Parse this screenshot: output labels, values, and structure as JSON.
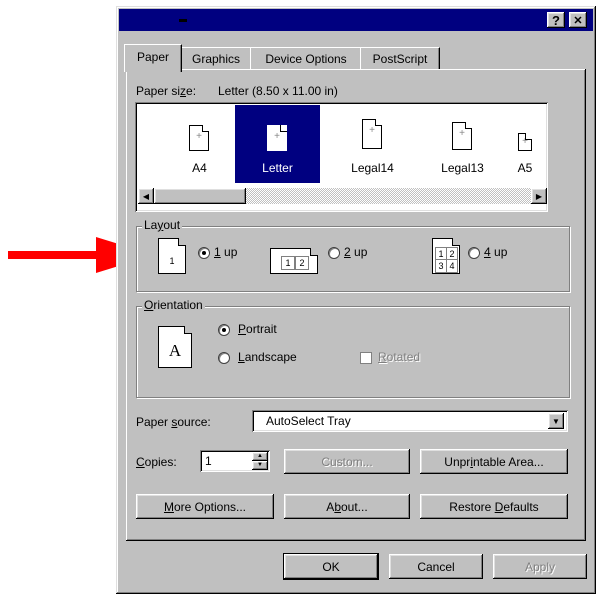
{
  "dialog": {
    "help_button": "?",
    "close_button": "✕"
  },
  "tabs": [
    {
      "label": "Paper"
    },
    {
      "label": "Graphics"
    },
    {
      "label": "Device Options"
    },
    {
      "label": "PostScript"
    }
  ],
  "paper": {
    "size_label": "Paper size:",
    "size_value": "Letter (8.50 x 11.00 in)",
    "items": [
      {
        "name": "A4"
      },
      {
        "name": "Letter"
      },
      {
        "name": "Legal14"
      },
      {
        "name": "Legal13"
      },
      {
        "name": "A5"
      }
    ],
    "selected": "Letter"
  },
  "layout": {
    "title": "Layout",
    "options": [
      {
        "label": "1 up",
        "checked": true
      },
      {
        "label": "2 up",
        "checked": false
      },
      {
        "label": "4 up",
        "checked": false
      }
    ],
    "icon_numbers": [
      "1",
      "1",
      "2",
      "1",
      "2",
      "3",
      "4"
    ]
  },
  "orientation": {
    "title": "Orientation",
    "icon_letter": "A",
    "portrait": "Portrait",
    "landscape": "Landscape",
    "rotated": "Rotated"
  },
  "paper_source": {
    "label": "Paper source:",
    "value": "AutoSelect Tray"
  },
  "copies": {
    "label": "Copies:",
    "value": "1"
  },
  "buttons": {
    "custom": "Custom...",
    "unprintable": "Unprintable Area...",
    "more_options": "More Options...",
    "about": "About...",
    "restore_defaults": "Restore Defaults",
    "ok": "OK",
    "cancel": "Cancel",
    "apply": "Apply"
  },
  "colors": {
    "arrow": "#ff0000",
    "titlebar": "#000080",
    "face": "#c0c0c0"
  }
}
